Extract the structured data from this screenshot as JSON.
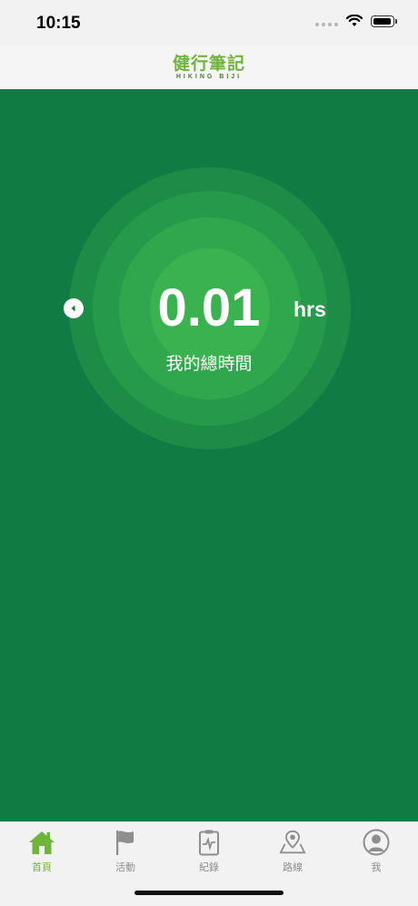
{
  "status_bar": {
    "time": "10:15"
  },
  "header": {
    "logo_title": "健行筆記",
    "logo_subtitle": "HIKING BIJI"
  },
  "summary": {
    "value": "0.01",
    "unit": "hrs",
    "label": "我的總時間"
  },
  "tabs": [
    {
      "label": "首頁",
      "icon": "home-icon",
      "active": true
    },
    {
      "label": "活動",
      "icon": "flag-icon",
      "active": false
    },
    {
      "label": "紀錄",
      "icon": "clipboard-icon",
      "active": false
    },
    {
      "label": "路線",
      "icon": "map-pin-icon",
      "active": false
    },
    {
      "label": "我",
      "icon": "profile-icon",
      "active": false
    }
  ],
  "colors": {
    "primary_green": "#0f7d43",
    "accent": "#6fb53a",
    "inactive": "#8e8e8e"
  }
}
